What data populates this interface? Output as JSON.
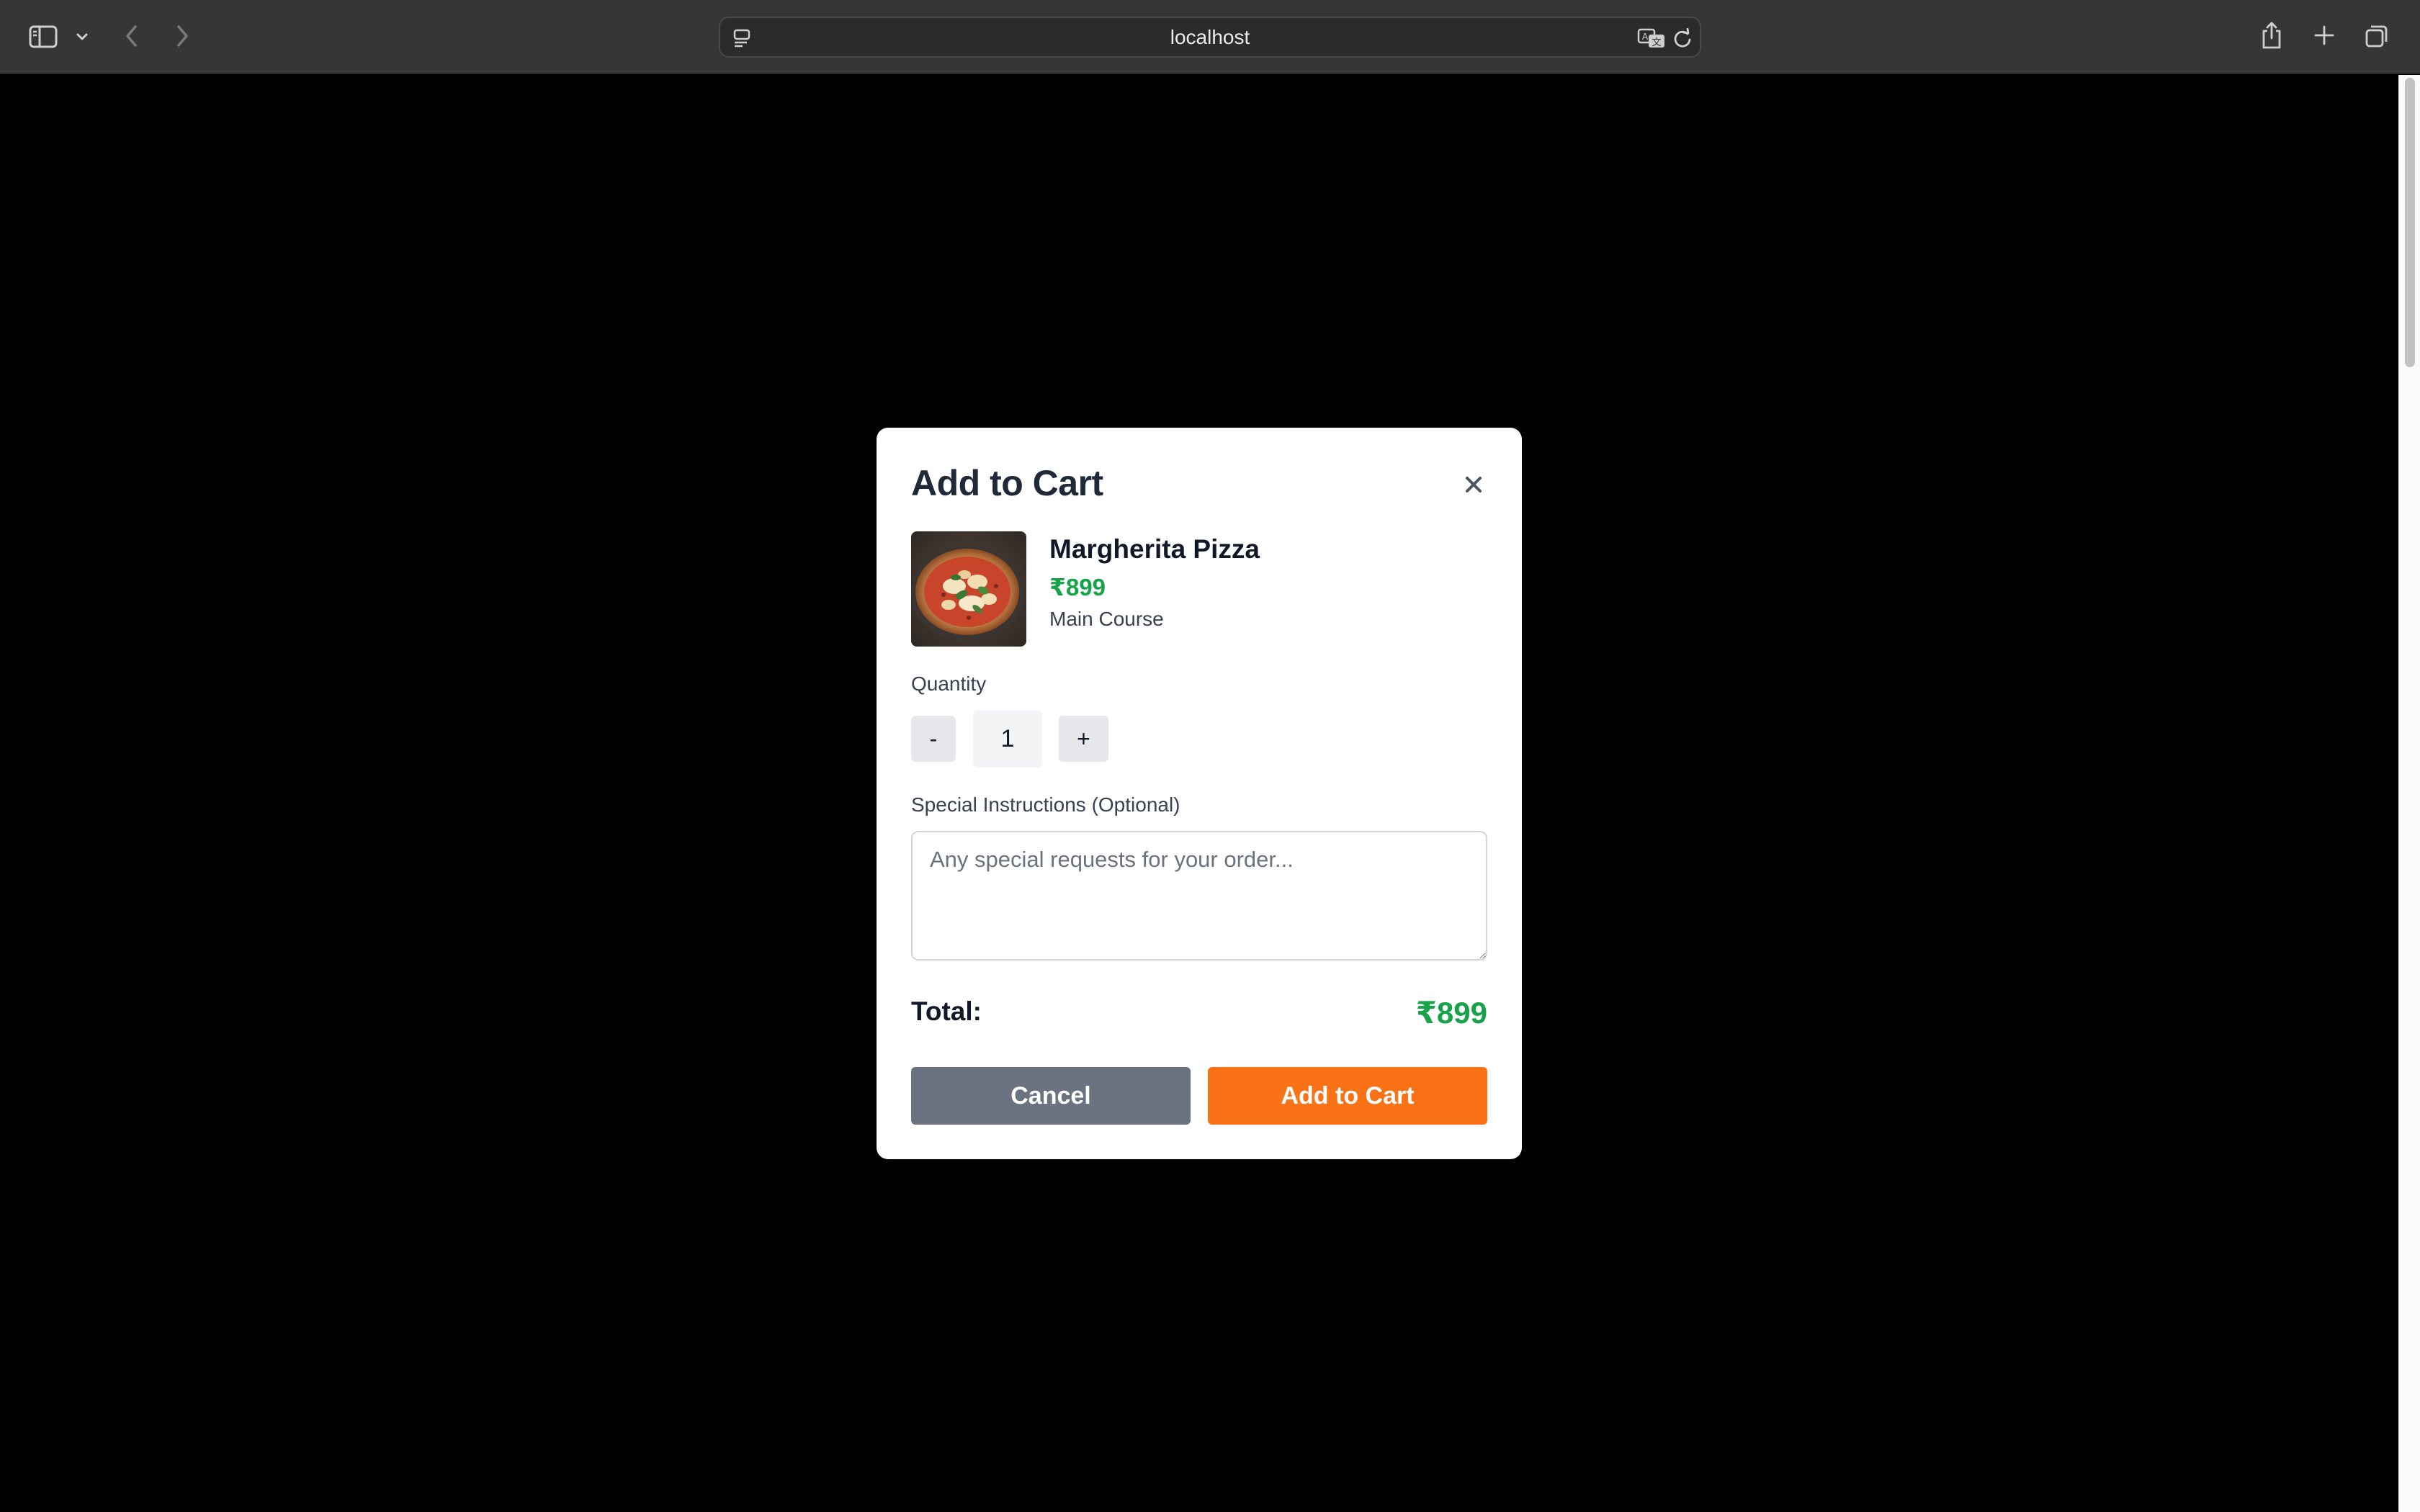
{
  "browser": {
    "url": "localhost",
    "icons": {
      "sidebar": "sidebar-icon",
      "sidebar_menu": "chevron-down-icon",
      "back": "chevron-left-icon",
      "forward": "chevron-right-icon",
      "page_menu": "page-settings-icon",
      "translate": "translate-icon",
      "reload": "reload-icon",
      "share": "share-icon",
      "new_tab": "plus-icon",
      "tabs_overview": "tabs-icon"
    }
  },
  "modal": {
    "title": "Add to Cart",
    "close_icon": "close-icon",
    "item": {
      "name": "Margherita Pizza",
      "price": "₹899",
      "category": "Main Course",
      "image": "pizza-image"
    },
    "quantity": {
      "label": "Quantity",
      "decrement_label": "-",
      "value": "1",
      "increment_label": "+"
    },
    "instructions": {
      "label": "Special Instructions (Optional)",
      "placeholder": "Any special requests for your order...",
      "value": ""
    },
    "total": {
      "label": "Total:",
      "value": "₹899"
    },
    "buttons": {
      "cancel": "Cancel",
      "add": "Add to Cart"
    }
  },
  "colors": {
    "price": "#16a34a",
    "add_button": "#f97316",
    "cancel_button": "#6b7280",
    "backdrop": "#000000"
  }
}
